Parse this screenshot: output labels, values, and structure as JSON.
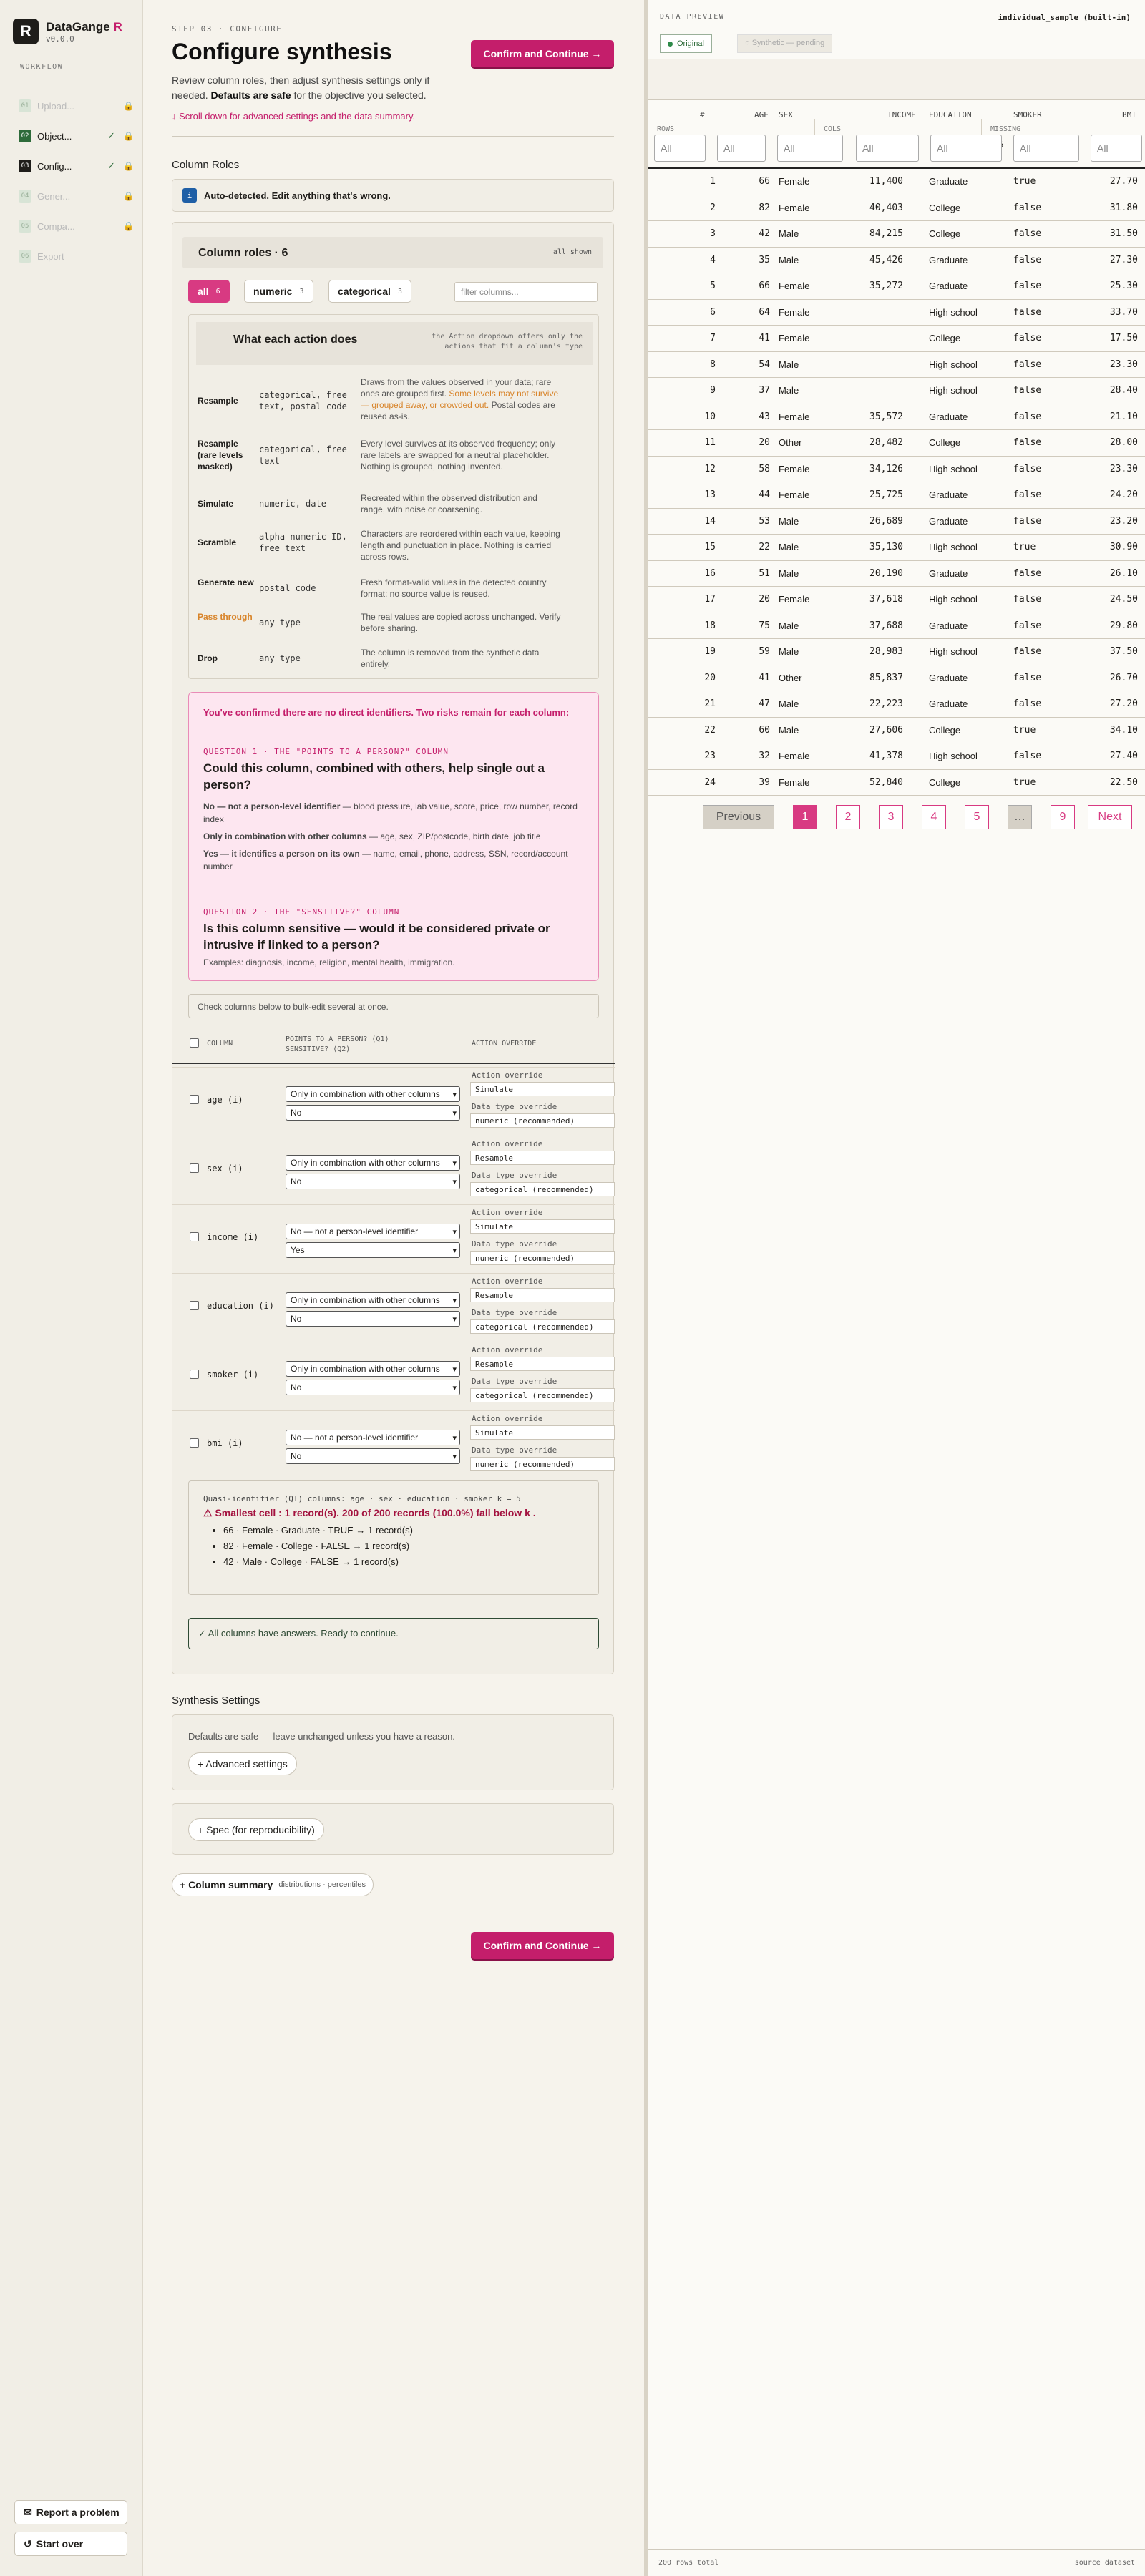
{
  "brand": {
    "logo_letter": "R",
    "name": "DataGange",
    "name_accent": "R",
    "version": "v0.0.0"
  },
  "sidebar": {
    "workflow_label": "WORKFLOW",
    "steps": [
      {
        "num": "01",
        "label": "Upload...",
        "state": "dim"
      },
      {
        "num": "02",
        "label": "Object...",
        "state": "done"
      },
      {
        "num": "03",
        "label": "Config...",
        "state": "current"
      },
      {
        "num": "04",
        "label": "Gener...",
        "state": "dim"
      },
      {
        "num": "05",
        "label": "Compa...",
        "state": "dim"
      },
      {
        "num": "06",
        "label": "Export",
        "state": "dim"
      }
    ],
    "report_button": "Report a problem",
    "startover_button": "Start over"
  },
  "header": {
    "step_tag": "STEP 03 · CONFIGURE",
    "title": "Configure synthesis",
    "lead_1": "Review column roles, then adjust synthesis settings only if needed.",
    "lead_bold": "Defaults are safe",
    "lead_2": "for the objective you selected.",
    "scroll_hint": "Scroll down for advanced settings and the data summary.",
    "confirm_button": "Confirm and Continue →"
  },
  "column_roles": {
    "section_title": "Column Roles",
    "auto_badge": "i",
    "auto_text": "Auto-detected. Edit anything that's wrong.",
    "card_title": "Column roles · 6",
    "all_shown": "all shown",
    "filters": [
      {
        "label": "all",
        "count": "6"
      },
      {
        "label": "numeric",
        "count": "3"
      },
      {
        "label": "categorical",
        "count": "3"
      }
    ],
    "filter_placeholder": "filter columns...",
    "actions_title": "What each action does",
    "actions_note": "the Action dropdown offers only the actions that fit a column's type",
    "actions": [
      {
        "name": "Resample",
        "types": "categorical, free text, postal code",
        "desc": "Draws from the values observed in your data; rare ones are grouped first.",
        "warn": "Some levels may not survive — grouped away, or crowded out.",
        "desc2": "Postal codes are reused as-is."
      },
      {
        "name": "Resample (rare levels masked)",
        "types": "categorical, free text",
        "desc": "Every level survives at its observed frequency; only rare labels are swapped for a neutral placeholder. Nothing is grouped, nothing invented."
      },
      {
        "name": "Simulate",
        "types": "numeric, date",
        "desc": "Recreated within the observed distribution and range, with noise or coarsening."
      },
      {
        "name": "Scramble",
        "types": "alpha-numeric ID, free text",
        "desc": "Characters are reordered within each value, keeping length and punctuation in place. Nothing is carried across rows."
      },
      {
        "name": "Generate new",
        "types": "postal code",
        "desc": "Fresh format-valid values in the detected country format; no source value is reused."
      },
      {
        "name": "Pass through",
        "types": "any type",
        "desc": "The real values are copied across unchanged. Verify before sharing."
      },
      {
        "name": "Drop",
        "types": "any type",
        "desc": "The column is removed from the synthetic data entirely."
      }
    ],
    "risk": {
      "intro": "You've confirmed there are no direct identifiers. Two risks remain for each column:",
      "q1_tag": "QUESTION 1 · THE \"POINTS TO A PERSON?\" COLUMN",
      "q1": "Could this column, combined with others, help single out a person?",
      "a1_bold": "No — not a person-level identifier",
      "a1": "— blood pressure, lab value, score, price, row number, record index",
      "a2_bold": "Only in combination with other columns",
      "a2": "— age, sex, ZIP/postcode, birth date, job title",
      "a3_bold": "Yes — it identifies a person on its own",
      "a3": "— name, email, phone, address, SSN, record/account number",
      "q2_tag": "QUESTION 2 · THE \"SENSITIVE?\" COLUMN",
      "q2": "Is this column sensitive — would it be considered private or intrusive if linked to a person?",
      "examples": "Examples: diagnosis, income, religion, mental health, immigration."
    },
    "bulk_hint": "Check columns below to bulk-edit several at once.",
    "table_headers": {
      "column": "COLUMN",
      "points": "POINTS TO A PERSON? (Q1)",
      "sensitive": "SENSITIVE? (Q2)",
      "action": "ACTION OVERRIDE"
    },
    "override_label": "Action override",
    "datatype_label": "Data type override",
    "columns": [
      {
        "name": "age (i)",
        "q1": "Only in combination with other columns",
        "q2": "No",
        "action": "Simulate",
        "dtype": "numeric (recommended)"
      },
      {
        "name": "sex (i)",
        "q1": "Only in combination with other columns",
        "q2": "No",
        "action": "Resample",
        "dtype": "categorical (recommended)"
      },
      {
        "name": "income (i)",
        "q1": "No — not a person-level identifier",
        "q2": "Yes",
        "action": "Simulate",
        "dtype": "numeric (recommended)"
      },
      {
        "name": "education (i)",
        "q1": "Only in combination with other columns",
        "q2": "No",
        "action": "Resample",
        "dtype": "categorical (recommended)"
      },
      {
        "name": "smoker (i)",
        "q1": "Only in combination with other columns",
        "q2": "No",
        "action": "Resample",
        "dtype": "categorical (recommended)"
      },
      {
        "name": "bmi (i)",
        "q1": "No — not a person-level identifier",
        "q2": "No",
        "action": "Simulate",
        "dtype": "numeric (recommended)"
      }
    ],
    "qi": {
      "line": "Quasi-identifier (QI) columns: age · sex · education · smoker  k = 5",
      "warn": "⚠ Smallest cell : 1 record(s). 200 of 200 records (100.0%) fall below k .",
      "items": [
        "66 · Female · Graduate · TRUE → 1 record(s)",
        "82 · Female · College · FALSE → 1 record(s)",
        "42 · Male · College · FALSE → 1 record(s)"
      ]
    },
    "ready": "✓ All columns have answers. Ready to continue."
  },
  "synthesis": {
    "title": "Synthesis Settings",
    "defaults_note": "Defaults are safe — leave unchanged unless you have a reason.",
    "advanced": "+ Advanced settings",
    "spec": "+ Spec (for reproducibility)",
    "summary": "+ Column summary",
    "summary_sub": "distributions · percentiles",
    "confirm_button": "Confirm and Continue →"
  },
  "preview": {
    "label": "DATA PREVIEW",
    "dataset": "individual_sample (built-in)",
    "tab_original": "Original",
    "tab_synthetic": "Synthetic — pending",
    "stats": [
      {
        "k": "ROWS",
        "v": "200"
      },
      {
        "k": "COLS",
        "v": "6"
      },
      {
        "k": "MISSING",
        "v": "1%"
      }
    ],
    "headers": [
      "#",
      "AGE",
      "SEX",
      "INCOME",
      "EDUCATION",
      "SMOKER",
      "BMI"
    ],
    "filter_value": "All",
    "rows": [
      [
        "1",
        "66",
        "Female",
        "11,400",
        "Graduate",
        "true",
        "27.70"
      ],
      [
        "2",
        "82",
        "Female",
        "40,403",
        "College",
        "false",
        "31.80"
      ],
      [
        "3",
        "42",
        "Male",
        "84,215",
        "College",
        "false",
        "31.50"
      ],
      [
        "4",
        "35",
        "Male",
        "45,426",
        "Graduate",
        "false",
        "27.30"
      ],
      [
        "5",
        "66",
        "Female",
        "35,272",
        "Graduate",
        "false",
        "25.30"
      ],
      [
        "6",
        "64",
        "Female",
        "",
        "High school",
        "false",
        "33.70"
      ],
      [
        "7",
        "41",
        "Female",
        "",
        "College",
        "false",
        "17.50"
      ],
      [
        "8",
        "54",
        "Male",
        "",
        "High school",
        "false",
        "23.30"
      ],
      [
        "9",
        "37",
        "Male",
        "",
        "High school",
        "false",
        "28.40"
      ],
      [
        "10",
        "43",
        "Female",
        "35,572",
        "Graduate",
        "false",
        "21.10"
      ],
      [
        "11",
        "20",
        "Other",
        "28,482",
        "College",
        "false",
        "28.00"
      ],
      [
        "12",
        "58",
        "Female",
        "34,126",
        "High school",
        "false",
        "23.30"
      ],
      [
        "13",
        "44",
        "Female",
        "25,725",
        "Graduate",
        "false",
        "24.20"
      ],
      [
        "14",
        "53",
        "Male",
        "26,689",
        "Graduate",
        "false",
        "23.20"
      ],
      [
        "15",
        "22",
        "Male",
        "35,130",
        "High school",
        "true",
        "30.90"
      ],
      [
        "16",
        "51",
        "Male",
        "20,190",
        "Graduate",
        "false",
        "26.10"
      ],
      [
        "17",
        "20",
        "Female",
        "37,618",
        "High school",
        "false",
        "24.50"
      ],
      [
        "18",
        "75",
        "Male",
        "37,688",
        "Graduate",
        "false",
        "29.80"
      ],
      [
        "19",
        "59",
        "Male",
        "28,983",
        "High school",
        "false",
        "37.50"
      ],
      [
        "20",
        "41",
        "Other",
        "85,837",
        "Graduate",
        "false",
        "26.70"
      ],
      [
        "21",
        "47",
        "Male",
        "22,223",
        "Graduate",
        "false",
        "27.20"
      ],
      [
        "22",
        "60",
        "Male",
        "27,606",
        "College",
        "true",
        "34.10"
      ],
      [
        "23",
        "32",
        "Female",
        "41,378",
        "High school",
        "false",
        "27.40"
      ],
      [
        "24",
        "39",
        "Female",
        "52,840",
        "College",
        "true",
        "22.50"
      ]
    ],
    "pagination": {
      "prev": "Previous",
      "pages": [
        "1",
        "2",
        "3",
        "4",
        "5",
        "…",
        "9"
      ],
      "next": "Next",
      "current": "1"
    },
    "footer_left": "200 rows total",
    "footer_right": "source dataset"
  }
}
